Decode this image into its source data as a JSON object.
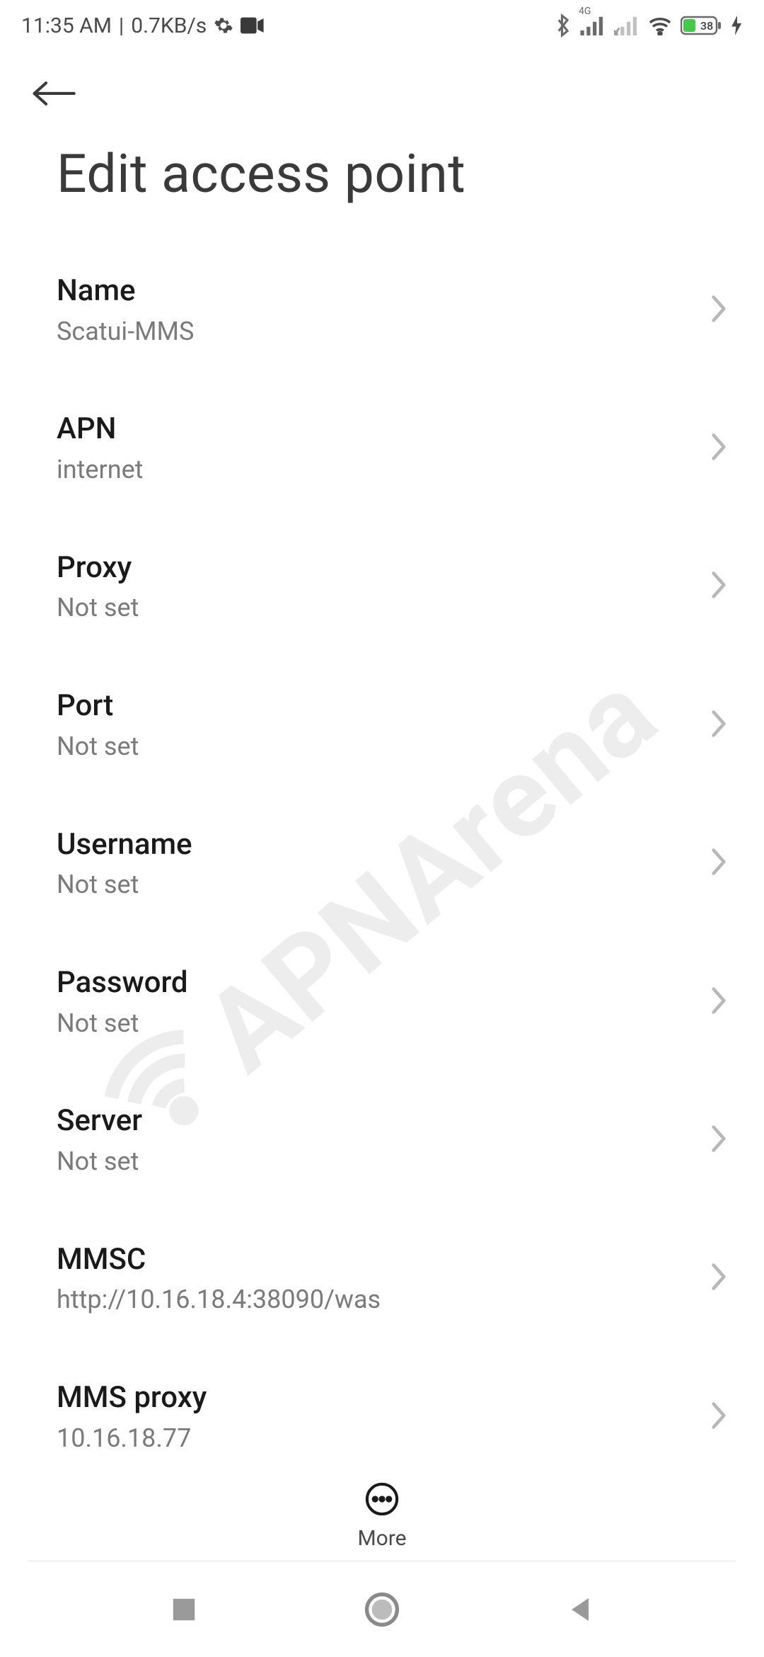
{
  "status": {
    "time": "11:35 AM",
    "sep": " | ",
    "net_speed": "0.7KB/s",
    "signal_label": "4G",
    "battery_pct": "38"
  },
  "page": {
    "title": "Edit access point"
  },
  "items": [
    {
      "label": "Name",
      "value": "Scatui-MMS"
    },
    {
      "label": "APN",
      "value": "internet"
    },
    {
      "label": "Proxy",
      "value": "Not set"
    },
    {
      "label": "Port",
      "value": "Not set"
    },
    {
      "label": "Username",
      "value": "Not set"
    },
    {
      "label": "Password",
      "value": "Not set"
    },
    {
      "label": "Server",
      "value": "Not set"
    },
    {
      "label": "MMSC",
      "value": "http://10.16.18.4:38090/was"
    },
    {
      "label": "MMS proxy",
      "value": "10.16.18.77"
    }
  ],
  "footer": {
    "more_label": "More"
  },
  "watermark": {
    "text": "APNArena"
  }
}
